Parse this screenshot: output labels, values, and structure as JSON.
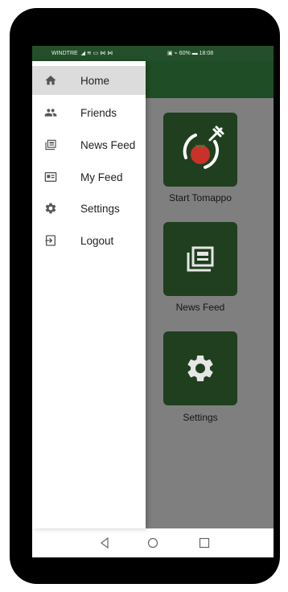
{
  "status_bar": {
    "carrier": "WINDTRE",
    "battery": "60%",
    "time": "18:08"
  },
  "drawer": {
    "items": [
      {
        "label": "Home",
        "icon": "home-icon",
        "active": true
      },
      {
        "label": "Friends",
        "icon": "people-icon",
        "active": false
      },
      {
        "label": "News Feed",
        "icon": "newspaper-icon",
        "active": false
      },
      {
        "label": "My Feed",
        "icon": "feed-card-icon",
        "active": false
      },
      {
        "label": "Settings",
        "icon": "gear-icon",
        "active": false
      },
      {
        "label": "Logout",
        "icon": "logout-icon",
        "active": false
      }
    ]
  },
  "main": {
    "tiles": [
      {
        "label": "Start Tomappo",
        "icon": "tomato-plate-icon"
      },
      {
        "label": "News Feed",
        "icon": "newspaper-icon"
      },
      {
        "label": "Settings",
        "icon": "gear-icon"
      }
    ]
  },
  "nav_bar": {
    "back": "back-icon",
    "home": "home-circle-icon",
    "recents": "recents-icon"
  },
  "colors": {
    "primary": "#1f4d26",
    "tile": "#1f3f1f",
    "scrim": "#7f7f7f",
    "tomato": "#c8322a"
  }
}
